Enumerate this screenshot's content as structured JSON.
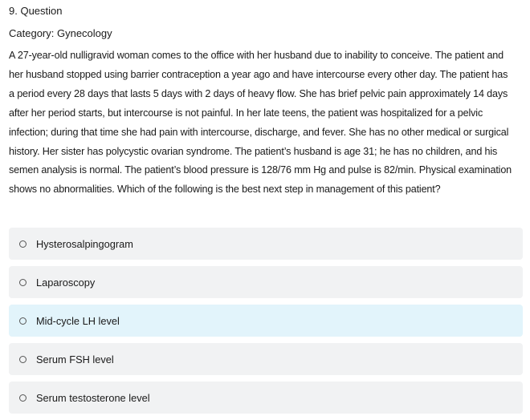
{
  "question": {
    "header": "9. Question",
    "category": "Category: Gynecology",
    "stem_lines": [
      "A 27-year-old nulligravid woman comes to the office with her husband due to inability to conceive.  The patient and",
      "her husband stopped using barrier contraception a year ago and have intercourse every other day.  The patient has",
      "a period every 28 days that lasts 5 days with 2 days of heavy flow.  She has brief pelvic pain approximately 14 days",
      "after her period starts, but intercourse is not painful.  In her late teens, the patient was hospitalized for a pelvic",
      "infection; during that time she had pain with intercourse, discharge, and fever.  She has no other medical or surgical",
      "history.  Her sister has polycystic ovarian syndrome.  The patient’s husband is age 31; he has no children, and his",
      "semen analysis is normal.  The patient’s blood pressure is 128/76 mm Hg and pulse is 82/min.  Physical examination",
      "shows no abnormalities.  Which of the following is the best next step in management of this patient?"
    ]
  },
  "options": [
    {
      "label": "Hysterosalpingogram",
      "selected": false,
      "highlighted": false
    },
    {
      "label": "Laparoscopy",
      "selected": false,
      "highlighted": false
    },
    {
      "label": "Mid-cycle LH level",
      "selected": false,
      "highlighted": true
    },
    {
      "label": "Serum FSH level",
      "selected": false,
      "highlighted": false
    },
    {
      "label": "Serum testosterone level",
      "selected": false,
      "highlighted": false
    }
  ],
  "colors": {
    "option_background": "#f1f2f3",
    "option_highlight": "#e2f4fb",
    "text": "#1a1a1a",
    "radio_border": "#555555"
  },
  "icons": {
    "radio": "radio-button-icon"
  }
}
